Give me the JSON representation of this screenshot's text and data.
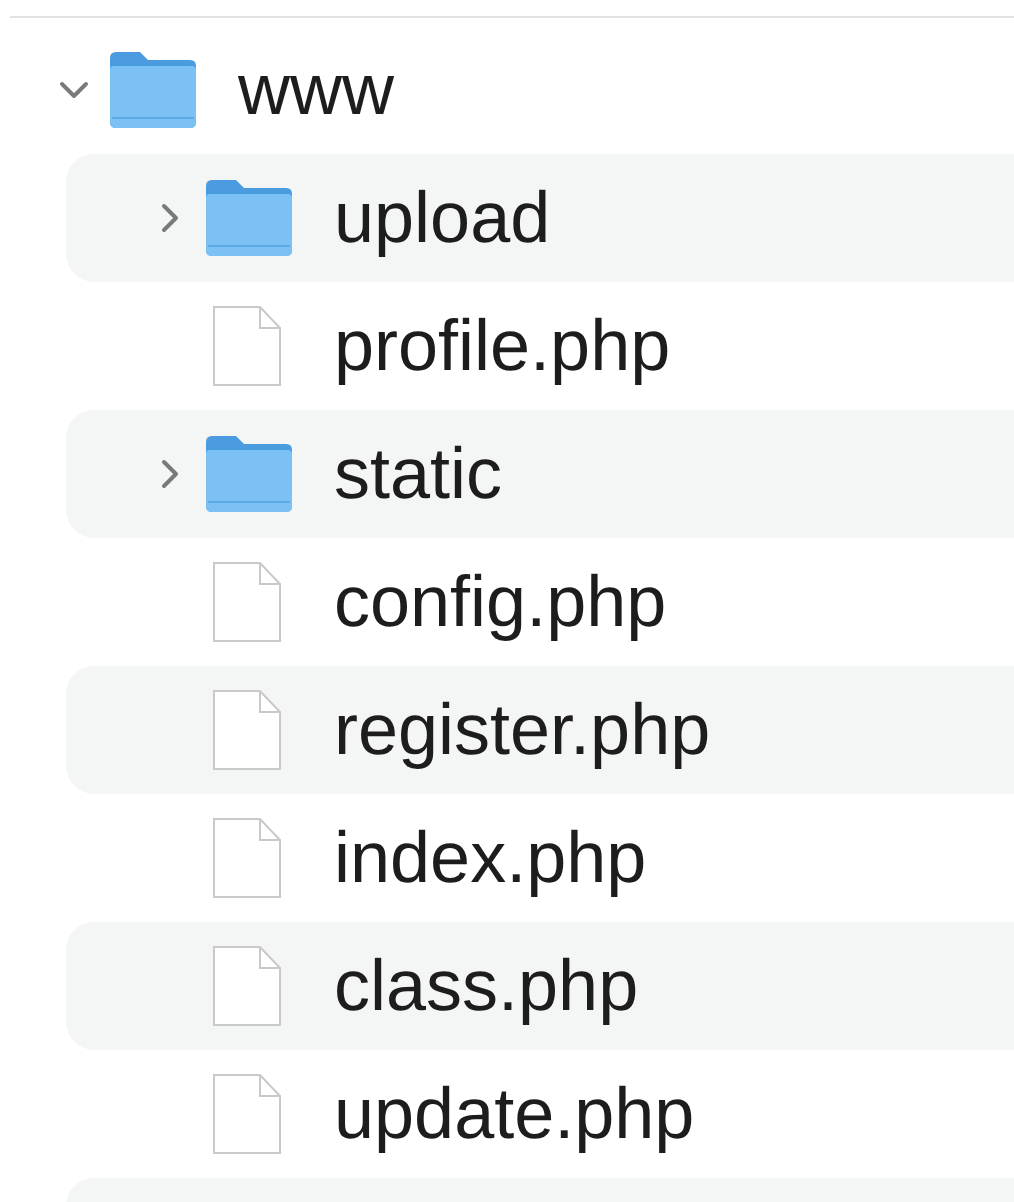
{
  "tree": [
    {
      "name": "www",
      "kind": "folder",
      "expanded": true,
      "children": [
        {
          "name": "upload",
          "kind": "folder",
          "expanded": false
        },
        {
          "name": "profile.php",
          "kind": "file"
        },
        {
          "name": "static",
          "kind": "folder",
          "expanded": false
        },
        {
          "name": "config.php",
          "kind": "file"
        },
        {
          "name": "register.php",
          "kind": "file"
        },
        {
          "name": "index.php",
          "kind": "file"
        },
        {
          "name": "class.php",
          "kind": "file"
        },
        {
          "name": "update.php",
          "kind": "file"
        }
      ]
    }
  ]
}
